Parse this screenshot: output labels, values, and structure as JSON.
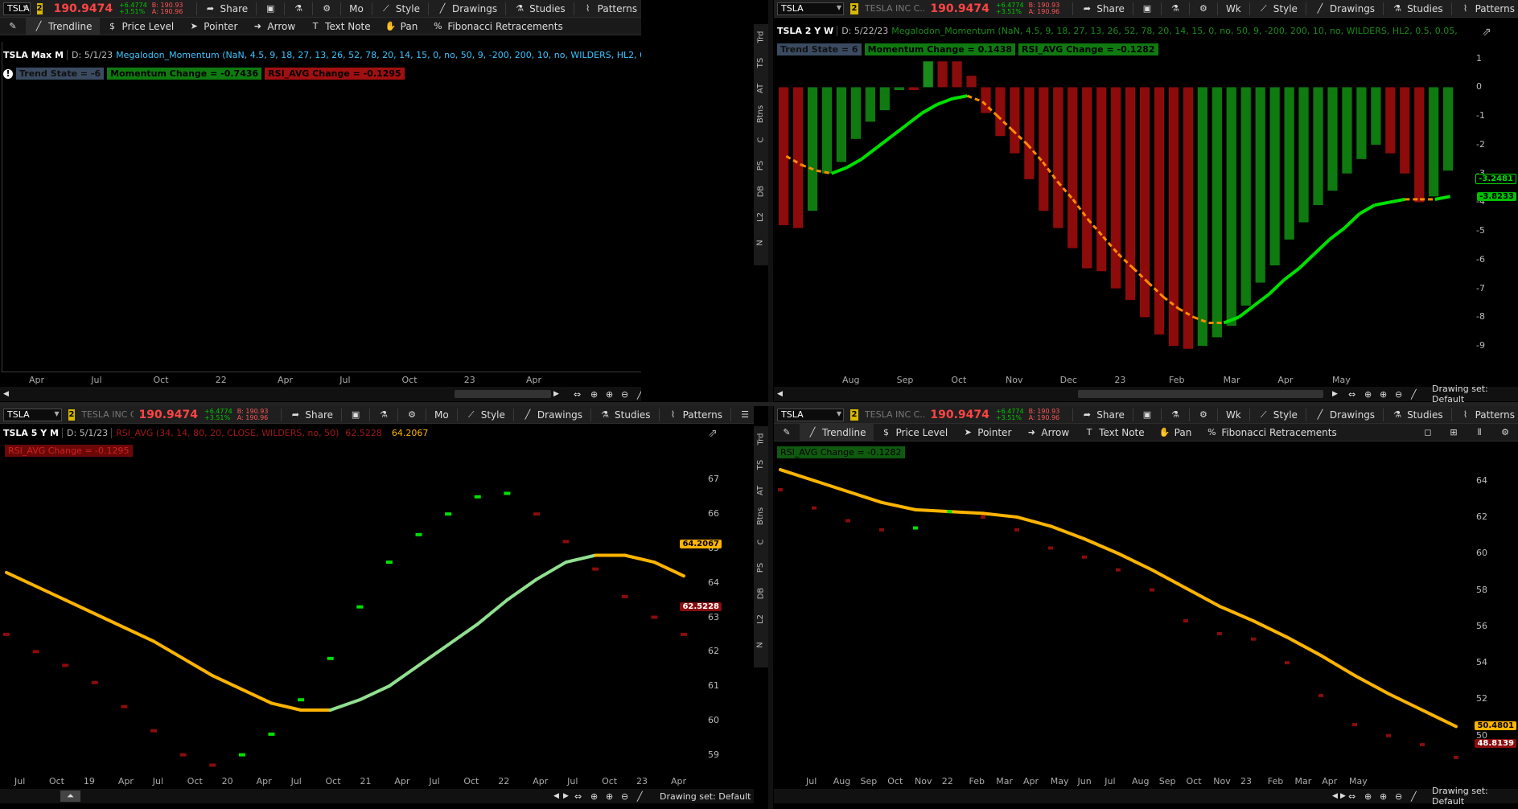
{
  "common": {
    "symbol": "TSLA",
    "link_badge": "2",
    "company": "TESLA INC C...",
    "price": "190.9474",
    "change_abs": "+6.4774",
    "change_pct": "+3.51%",
    "bid": "B: 190.93",
    "ask": "A: 190.96",
    "share": "Share",
    "style": "Style",
    "drawings": "Drawings",
    "studies": "Studies",
    "patterns": "Patterns",
    "drawing_set": "Drawing set: Default"
  },
  "drawing_tools": {
    "trendline": "Trendline",
    "price_level": "Price Level",
    "pointer": "Pointer",
    "arrow": "Arrow",
    "text_note": "Text Note",
    "pan": "Pan",
    "fib": "Fibonacci Retracements"
  },
  "side_tabs": [
    "Trd",
    "TS",
    "AT",
    "Btns",
    "C",
    "PS",
    "DB",
    "L2",
    "N"
  ],
  "panel_tl": {
    "aggregation": "Mo",
    "title": "TSLA Max M",
    "date": "D: 5/1/23",
    "study": "Megalodon_Momentum (NaN, 4.5, 9, 18, 27, 13, 26, 52, 78, 20, 14, 15, 0, no, 50, 9, -200, 200, 10, no, WILDERS, HL2, 0.5, 0.05, CLOSE, 20, 5, 10,...",
    "trend_state": "Trend State = -6",
    "momentum_change": "Momentum Change = -0.7436",
    "rsi_avg_change": "RSI_AVG Change = -0.1295",
    "x_labels": [
      "Apr",
      "Jul",
      "Oct",
      "22",
      "Apr",
      "Jul",
      "Oct",
      "23",
      "Apr"
    ]
  },
  "panel_tr": {
    "aggregation": "Wk",
    "title": "TSLA 2 Y W",
    "date": "D: 5/22/23",
    "study": "Megalodon_Momentum (NaN, 4.5, 9, 18, 27, 13, 26, 52, 78, 20, 14, 15, 0, no, 50, 9, -200, 200, 10, no, WILDERS, HL2, 0.5, 0.05, CLOSE, 20, 5, 10...",
    "trend_state": "Trend State = 6",
    "momentum_change": "Momentum Change = 0.1438",
    "rsi_avg_change": "RSI_AVG Change = -0.1282",
    "y_labels": [
      "1",
      "0",
      "-1",
      "-2",
      "-3",
      "-4",
      "-5",
      "-6",
      "-7",
      "-8",
      "-9"
    ],
    "x_labels": [
      "Aug",
      "Sep",
      "Oct",
      "Nov",
      "Dec",
      "23",
      "Feb",
      "Mar",
      "Apr",
      "May"
    ],
    "tag_a": "-3.2481",
    "tag_b": "-3.8233"
  },
  "panel_bl": {
    "aggregation": "Mo",
    "title": "TSLA 5 Y M",
    "date": "D: 5/1/23",
    "study": "RSI_AVG (34, 14, 80, 20, CLOSE, WILDERS, no, 50)",
    "study_v1": "62.5228",
    "study_v2": "64.2067",
    "rsi_avg_change": "RSI_AVG Change = -0.1295",
    "y_labels": [
      "67",
      "66",
      "65",
      "64",
      "63",
      "62",
      "61",
      "60",
      "59"
    ],
    "x_labels": [
      "Jul",
      "Oct",
      "19",
      "Apr",
      "Jul",
      "Oct",
      "20",
      "Apr",
      "Jul",
      "Oct",
      "21",
      "Apr",
      "Jul",
      "Oct",
      "22",
      "Apr",
      "Jul",
      "Oct",
      "23",
      "Apr"
    ],
    "tag_a": "64.2067",
    "tag_b": "62.5228"
  },
  "panel_br": {
    "aggregation": "Wk",
    "rsi_avg_change": "RSI_AVG Change = -0.1282",
    "y_labels": [
      "64",
      "62",
      "60",
      "58",
      "56",
      "54",
      "52",
      "50"
    ],
    "x_labels": [
      "Jul",
      "Aug",
      "Sep",
      "Oct",
      "Nov",
      "22",
      "Feb",
      "Mar",
      "Apr",
      "May",
      "Jun",
      "Jul",
      "Aug",
      "Sep",
      "Oct",
      "Nov",
      "23",
      "Feb",
      "Mar",
      "Apr",
      "May"
    ],
    "tag_a": "50.4801",
    "tag_b": "48.8139"
  },
  "chart_data": [
    {
      "type": "bar",
      "panel": "TSLA 2 Y W",
      "series": [
        {
          "name": "Momentum",
          "values": [
            -4.8,
            -4.9,
            -4.3,
            -3.0,
            -2.6,
            -1.8,
            -1.2,
            -0.8,
            -0.1,
            -0.1,
            0.9,
            0.9,
            0.9,
            0.4,
            -0.9,
            -1.7,
            -2.3,
            -3.2,
            -4.3,
            -4.9,
            -5.6,
            -6.3,
            -6.4,
            -7.0,
            -7.4,
            -8.0,
            -8.6,
            -9.0,
            -9.1,
            -9.0,
            -8.7,
            -8.3,
            -7.6,
            -6.8,
            -6.2,
            -5.3,
            -4.7,
            -4.1,
            -3.6,
            -3.0,
            -2.5,
            -2.0,
            -2.3,
            -3.0,
            -4.0,
            -3.8,
            -2.9
          ]
        },
        {
          "name": "RSI_AVG",
          "values": [
            -2.4,
            -2.7,
            -2.9,
            -3.0,
            -2.8,
            -2.5,
            -2.1,
            -1.7,
            -1.3,
            -0.9,
            -0.6,
            -0.4,
            -0.3,
            -0.5,
            -1.0,
            -1.5,
            -2.0,
            -2.6,
            -3.3,
            -3.9,
            -4.6,
            -5.2,
            -5.8,
            -6.3,
            -6.8,
            -7.3,
            -7.7,
            -8.0,
            -8.2,
            -8.2,
            -8.0,
            -7.6,
            -7.2,
            -6.7,
            -6.3,
            -5.8,
            -5.3,
            -4.9,
            -4.4,
            -4.1,
            -4.0,
            -3.9,
            -3.9,
            -3.9,
            -3.8
          ]
        }
      ],
      "ylim": [
        -9.5,
        1.3
      ]
    },
    {
      "type": "line",
      "panel": "TSLA 5 Y M",
      "series": [
        {
          "name": "RSI_AVG",
          "values": [
            64.3,
            63.9,
            63.5,
            63.1,
            62.7,
            62.3,
            61.8,
            61.3,
            60.9,
            60.5,
            60.3,
            60.3,
            60.6,
            61.0,
            61.6,
            62.2,
            62.8,
            63.5,
            64.1,
            64.6,
            64.8,
            64.8,
            64.6,
            64.2
          ]
        },
        {
          "name": "RSI",
          "values": [
            62.5,
            62.0,
            61.6,
            61.1,
            60.4,
            59.7,
            59.0,
            58.7,
            59.0,
            59.6,
            60.6,
            61.8,
            63.3,
            64.6,
            65.4,
            66.0,
            66.5,
            66.6,
            66.0,
            65.2,
            64.4,
            63.6,
            63.0,
            62.5
          ]
        }
      ],
      "ylim": [
        58.5,
        67.5
      ]
    },
    {
      "type": "line",
      "panel": "TSLA Wk",
      "series": [
        {
          "name": "RSI_AVG",
          "values": [
            64.6,
            64.0,
            63.4,
            62.8,
            62.4,
            62.3,
            62.2,
            62.0,
            61.5,
            60.8,
            60.0,
            59.1,
            58.1,
            57.1,
            56.3,
            55.4,
            54.4,
            53.3,
            52.3,
            51.4,
            50.5
          ]
        },
        {
          "name": "RSI",
          "values": [
            63.5,
            62.5,
            61.8,
            61.3,
            61.4,
            62.3,
            62.0,
            61.3,
            60.3,
            59.8,
            59.1,
            58.0,
            56.3,
            55.6,
            55.3,
            54.0,
            52.2,
            50.6,
            50.0,
            49.5,
            48.8
          ]
        }
      ],
      "ylim": [
        48.0,
        65.0
      ]
    }
  ]
}
